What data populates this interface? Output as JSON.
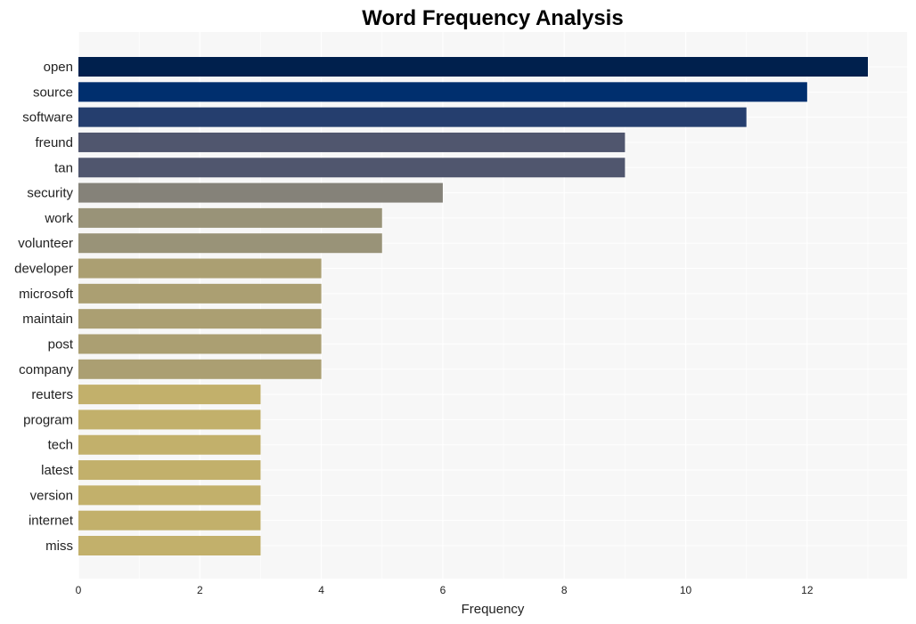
{
  "chart_data": {
    "type": "bar",
    "orientation": "horizontal",
    "title": "Word Frequency Analysis",
    "xlabel": "Frequency",
    "ylabel": "",
    "xlim": [
      0,
      13.65
    ],
    "xticks": [
      0,
      2,
      4,
      6,
      8,
      10,
      12
    ],
    "grid": true,
    "legend": "none",
    "categories": [
      "open",
      "source",
      "software",
      "freund",
      "tan",
      "security",
      "work",
      "volunteer",
      "developer",
      "microsoft",
      "maintain",
      "post",
      "company",
      "reuters",
      "program",
      "tech",
      "latest",
      "version",
      "internet",
      "miss"
    ],
    "values": [
      13,
      12,
      11,
      9,
      9,
      6,
      5,
      5,
      4,
      4,
      4,
      4,
      4,
      3,
      3,
      3,
      3,
      3,
      3,
      3
    ],
    "colors": [
      "#00204d",
      "#002f6e",
      "#253e6e",
      "#50566e",
      "#50566e",
      "#858279",
      "#999378",
      "#999378",
      "#ab9f72",
      "#ab9f72",
      "#ab9f72",
      "#ab9f72",
      "#ab9f72",
      "#c2b06b",
      "#c2b06b",
      "#c2b06b",
      "#c2b06b",
      "#c2b06b",
      "#c2b06b",
      "#c2b06b"
    ]
  }
}
